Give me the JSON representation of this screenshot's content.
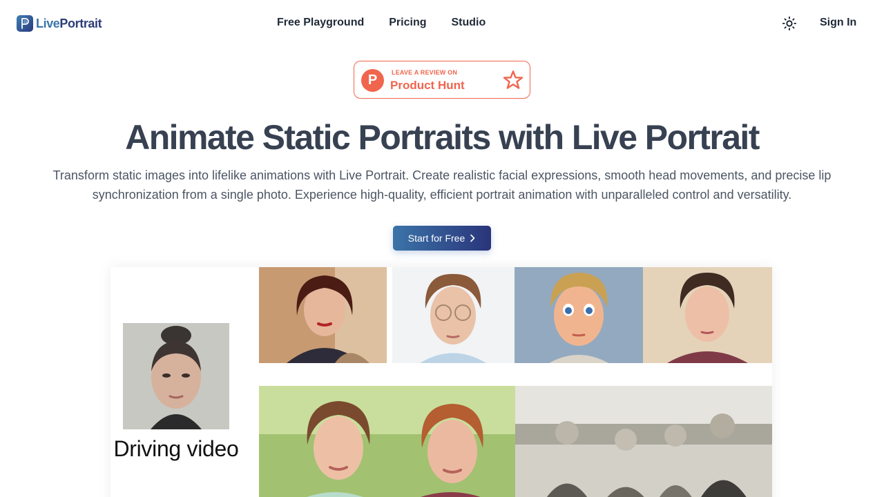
{
  "brand": {
    "name_part1": "Live",
    "name_part2": "Portrait"
  },
  "nav": {
    "links": [
      "Free Playground",
      "Pricing",
      "Studio"
    ],
    "sign_in": "Sign In"
  },
  "badge": {
    "small_text": "LEAVE A REVIEW ON",
    "big_text": "Product Hunt",
    "logo_letter": "P"
  },
  "hero": {
    "title": "Animate Static Portraits with Live Portrait",
    "subtitle": "Transform static images into lifelike animations with Live Portrait. Create realistic facial expressions, smooth head movements, and precise lip synchronization from a single photo. Experience high-quality, efficient portrait animation with unparalleled control and versatility.",
    "cta": "Start for Free"
  },
  "showcase": {
    "driving_label": "Driving video"
  },
  "colors": {
    "accent": "#3b74a8",
    "accent_dark": "#2a347a",
    "product_hunt": "#f0654d",
    "heading": "#374151"
  },
  "icons": [
    "logo-icon",
    "sun-icon",
    "product-hunt-icon",
    "star-icon",
    "chevron-right-icon"
  ]
}
